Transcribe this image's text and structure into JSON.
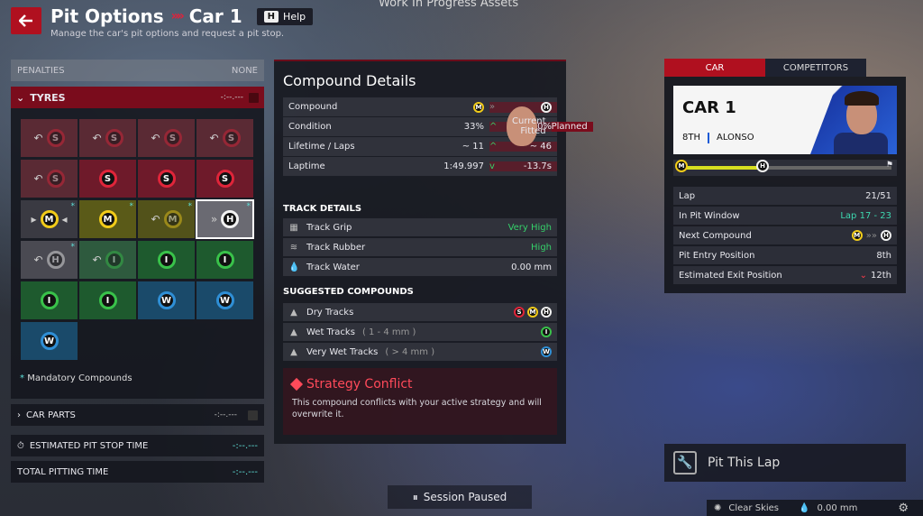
{
  "header": {
    "title": "Pit Options",
    "separator": "»",
    "car": "Car 1",
    "help_key": "H",
    "help_label": "Help",
    "subtitle": "Manage the car's pit options and request a pit stop.",
    "overlay": "Work In Progress Assets"
  },
  "left": {
    "penalties_label": "PENALTIES",
    "penalties_value": "NONE",
    "tyres_label": "TYRES",
    "tyres_time": "-:--.---",
    "tyres": [
      {
        "compound": "S",
        "state": "used"
      },
      {
        "compound": "S",
        "state": "used"
      },
      {
        "compound": "S",
        "state": "used"
      },
      {
        "compound": "S",
        "state": "used"
      },
      {
        "compound": "S",
        "state": "used"
      },
      {
        "compound": "S",
        "state": "new"
      },
      {
        "compound": "S",
        "state": "new"
      },
      {
        "compound": "S",
        "state": "new"
      },
      {
        "compound": "M",
        "state": "fitted",
        "mandatory": true
      },
      {
        "compound": "M",
        "state": "new",
        "mandatory": true
      },
      {
        "compound": "M",
        "state": "used",
        "mandatory": true
      },
      {
        "compound": "H",
        "state": "selected",
        "mandatory": true
      },
      {
        "compound": "H",
        "state": "used",
        "mandatory": true
      },
      {
        "compound": "I",
        "state": "used"
      },
      {
        "compound": "I",
        "state": "new"
      },
      {
        "compound": "I",
        "state": "new"
      },
      {
        "compound": "I",
        "state": "new"
      },
      {
        "compound": "I",
        "state": "new"
      },
      {
        "compound": "W",
        "state": "new"
      },
      {
        "compound": "W",
        "state": "new"
      },
      {
        "compound": "W",
        "state": "new"
      }
    ],
    "mandatory_label": "Mandatory Compounds",
    "mandatory_star": "*",
    "car_parts_label": "CAR PARTS",
    "car_parts_time": "-:--.---",
    "pit_stop_label": "ESTIMATED PIT STOP TIME",
    "pit_stop_value": "-:--.---",
    "pitting_label": "TOTAL PITTING TIME",
    "pitting_value": "-:--.---"
  },
  "compound": {
    "title": "Compound Details",
    "col_current": "Current Fitted",
    "col_planned": "Planned",
    "rows": [
      {
        "label": "Compound",
        "current": "M",
        "planned": "H",
        "arrow": "»"
      },
      {
        "label": "Condition",
        "current": "33%",
        "planned": "100%",
        "arrow": "^"
      },
      {
        "label": "Lifetime / Laps",
        "current": "~ 11",
        "planned": "~ 46",
        "arrow": "^"
      },
      {
        "label": "Laptime",
        "current": "1:49.997",
        "planned": "-13.7s",
        "arrow": "v"
      }
    ],
    "track_title": "TRACK DETAILS",
    "track": [
      {
        "label": "Track Grip",
        "value": "Very High"
      },
      {
        "label": "Track Rubber",
        "value": "High"
      },
      {
        "label": "Track Water",
        "value": "0.00 mm"
      }
    ],
    "suggest_title": "SUGGESTED COMPOUNDS",
    "suggest": [
      {
        "label": "Dry Tracks",
        "range": "",
        "compounds": [
          "S",
          "M",
          "H"
        ]
      },
      {
        "label": "Wet Tracks",
        "range": "( 1 - 4 mm )",
        "compounds": [
          "I"
        ]
      },
      {
        "label": "Very Wet Tracks",
        "range": "( > 4 mm )",
        "compounds": [
          "W"
        ]
      }
    ],
    "conflict_title": "Strategy Conflict",
    "conflict_desc": "This compound conflicts with your active strategy and will overwrite it."
  },
  "right": {
    "tab_car": "CAR",
    "tab_competitors": "COMPETITORS",
    "car_name": "CAR 1",
    "position": "8TH",
    "driver": "ALONSO",
    "stats": [
      {
        "label": "Lap",
        "value": "21/51"
      },
      {
        "label": "In Pit Window",
        "value": "Lap 17 - 23"
      },
      {
        "label": "Next Compound",
        "value": ""
      },
      {
        "label": "Pit Entry Position",
        "value": "8th"
      },
      {
        "label": "Estimated Exit Position",
        "value": "12th"
      }
    ],
    "pit_this_lap": "Pit This Lap"
  },
  "bottom": {
    "session": "Session Paused",
    "weather": "Clear Skies",
    "water": "0.00 mm"
  },
  "colors": {
    "accent": "#b0101f",
    "soft": "#e0253a",
    "medium": "#f2cc1a",
    "hard": "#f2f2f2",
    "inter": "#39c24a",
    "wet": "#2f8fd6",
    "teal": "#5ee0d8"
  }
}
